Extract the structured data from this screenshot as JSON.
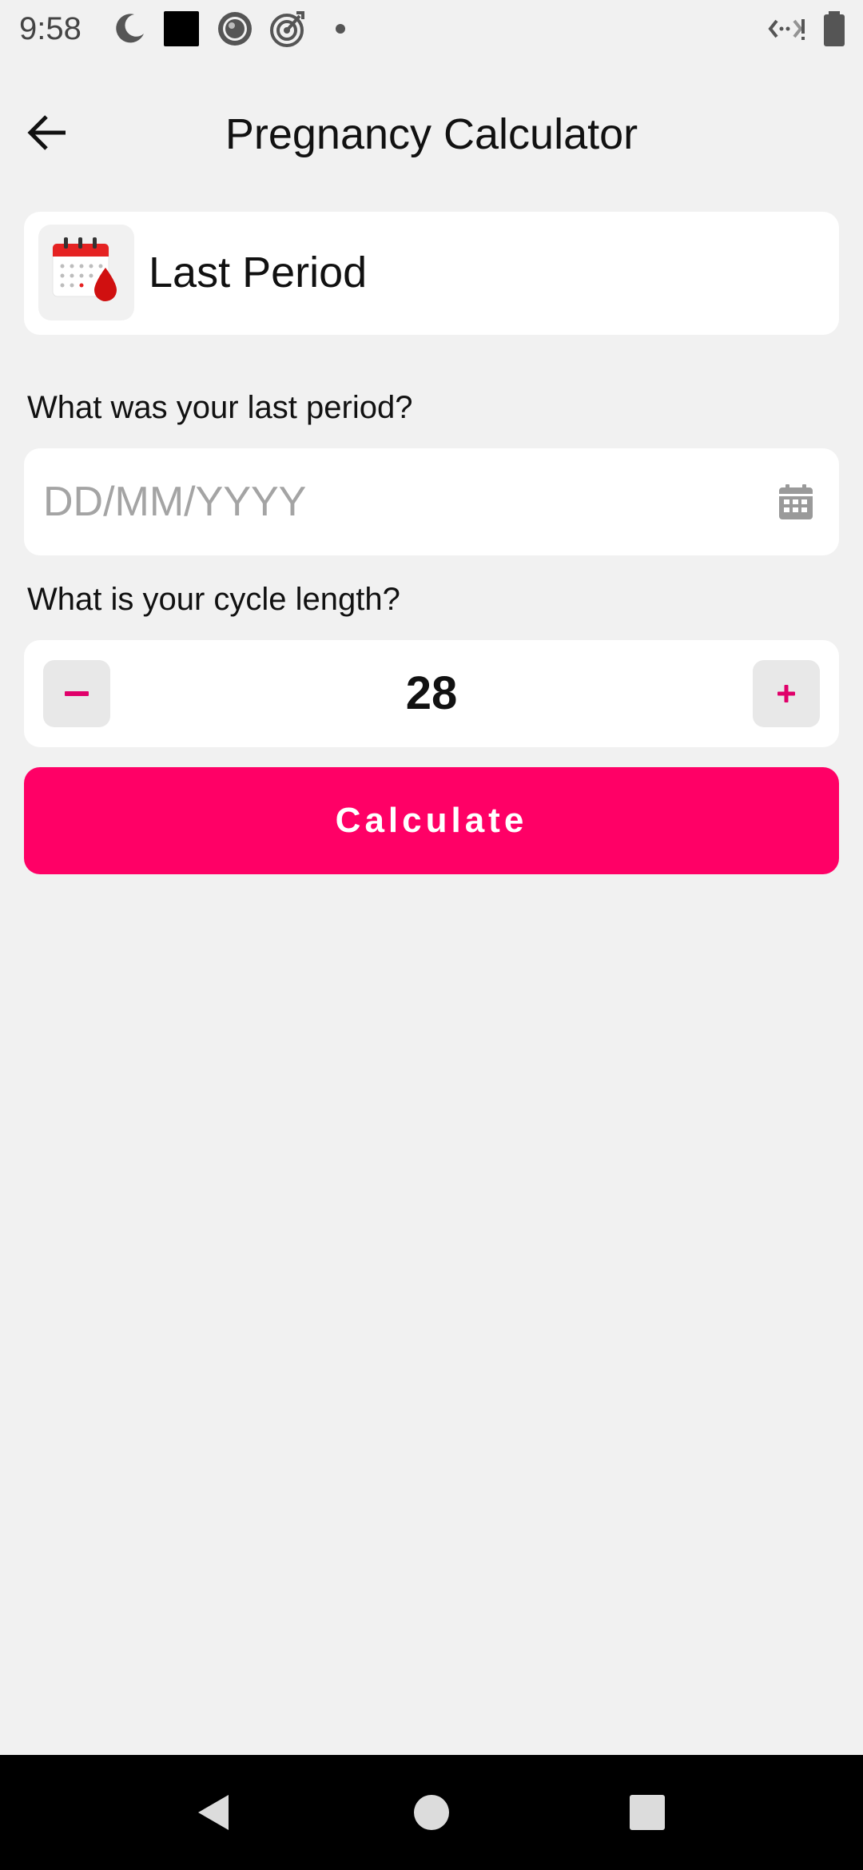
{
  "status_bar": {
    "time": "9:58",
    "left_icons": [
      "do-not-disturb-icon",
      "app-square-icon",
      "camera-lens-icon",
      "target-icon",
      "dot-icon"
    ],
    "right_icons": [
      "data-saver-icon",
      "battery-icon"
    ]
  },
  "app_bar": {
    "title": "Pregnancy Calculator",
    "back_icon": "arrow-left-icon"
  },
  "header_card": {
    "title": "Last Period",
    "icon": "calendar-blood-drop-icon"
  },
  "last_period": {
    "label": "What was your last period?",
    "placeholder": "DD/MM/YYYY",
    "value": "",
    "icon": "calendar-icon"
  },
  "cycle_length": {
    "label": "What is your cycle length?",
    "value": "28",
    "decrement_icon": "minus-icon",
    "increment_icon": "plus-icon"
  },
  "calculate_button": {
    "label": "Calculate"
  },
  "colors": {
    "accent": "#ff0066",
    "background": "#f1f1f1",
    "card": "#ffffff"
  },
  "nav_bar": {
    "icons": [
      "nav-back-icon",
      "nav-home-icon",
      "nav-recents-icon"
    ]
  }
}
